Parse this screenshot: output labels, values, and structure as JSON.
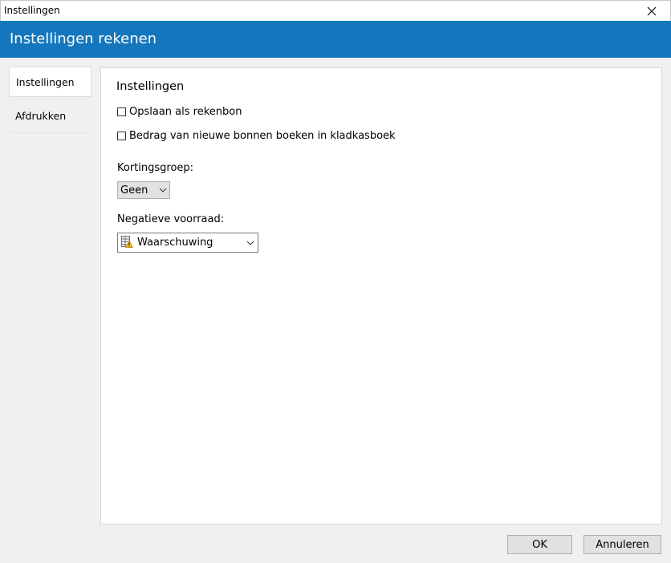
{
  "window": {
    "title": "Instellingen"
  },
  "header": {
    "title": "Instellingen rekenen"
  },
  "sidebar": {
    "items": [
      {
        "label": "Instellingen",
        "active": true
      },
      {
        "label": "Afdrukken",
        "active": false
      }
    ]
  },
  "panel": {
    "title": "Instellingen",
    "checkboxes": [
      {
        "label": "Opslaan als rekenbon",
        "checked": false
      },
      {
        "label": "Bedrag van nieuwe bonnen boeken in kladkasboek",
        "checked": false
      }
    ],
    "discount_group": {
      "label": "Kortingsgroep:",
      "value": "Geen"
    },
    "negative_stock": {
      "label": "Negatieve voorraad:",
      "value": "Waarschuwing",
      "icon": "warning-table-icon"
    }
  },
  "buttons": {
    "ok": "OK",
    "cancel": "Annuleren"
  },
  "colors": {
    "accent": "#1477bd",
    "window_bg": "#f0f0f0",
    "panel_bg": "#ffffff"
  }
}
